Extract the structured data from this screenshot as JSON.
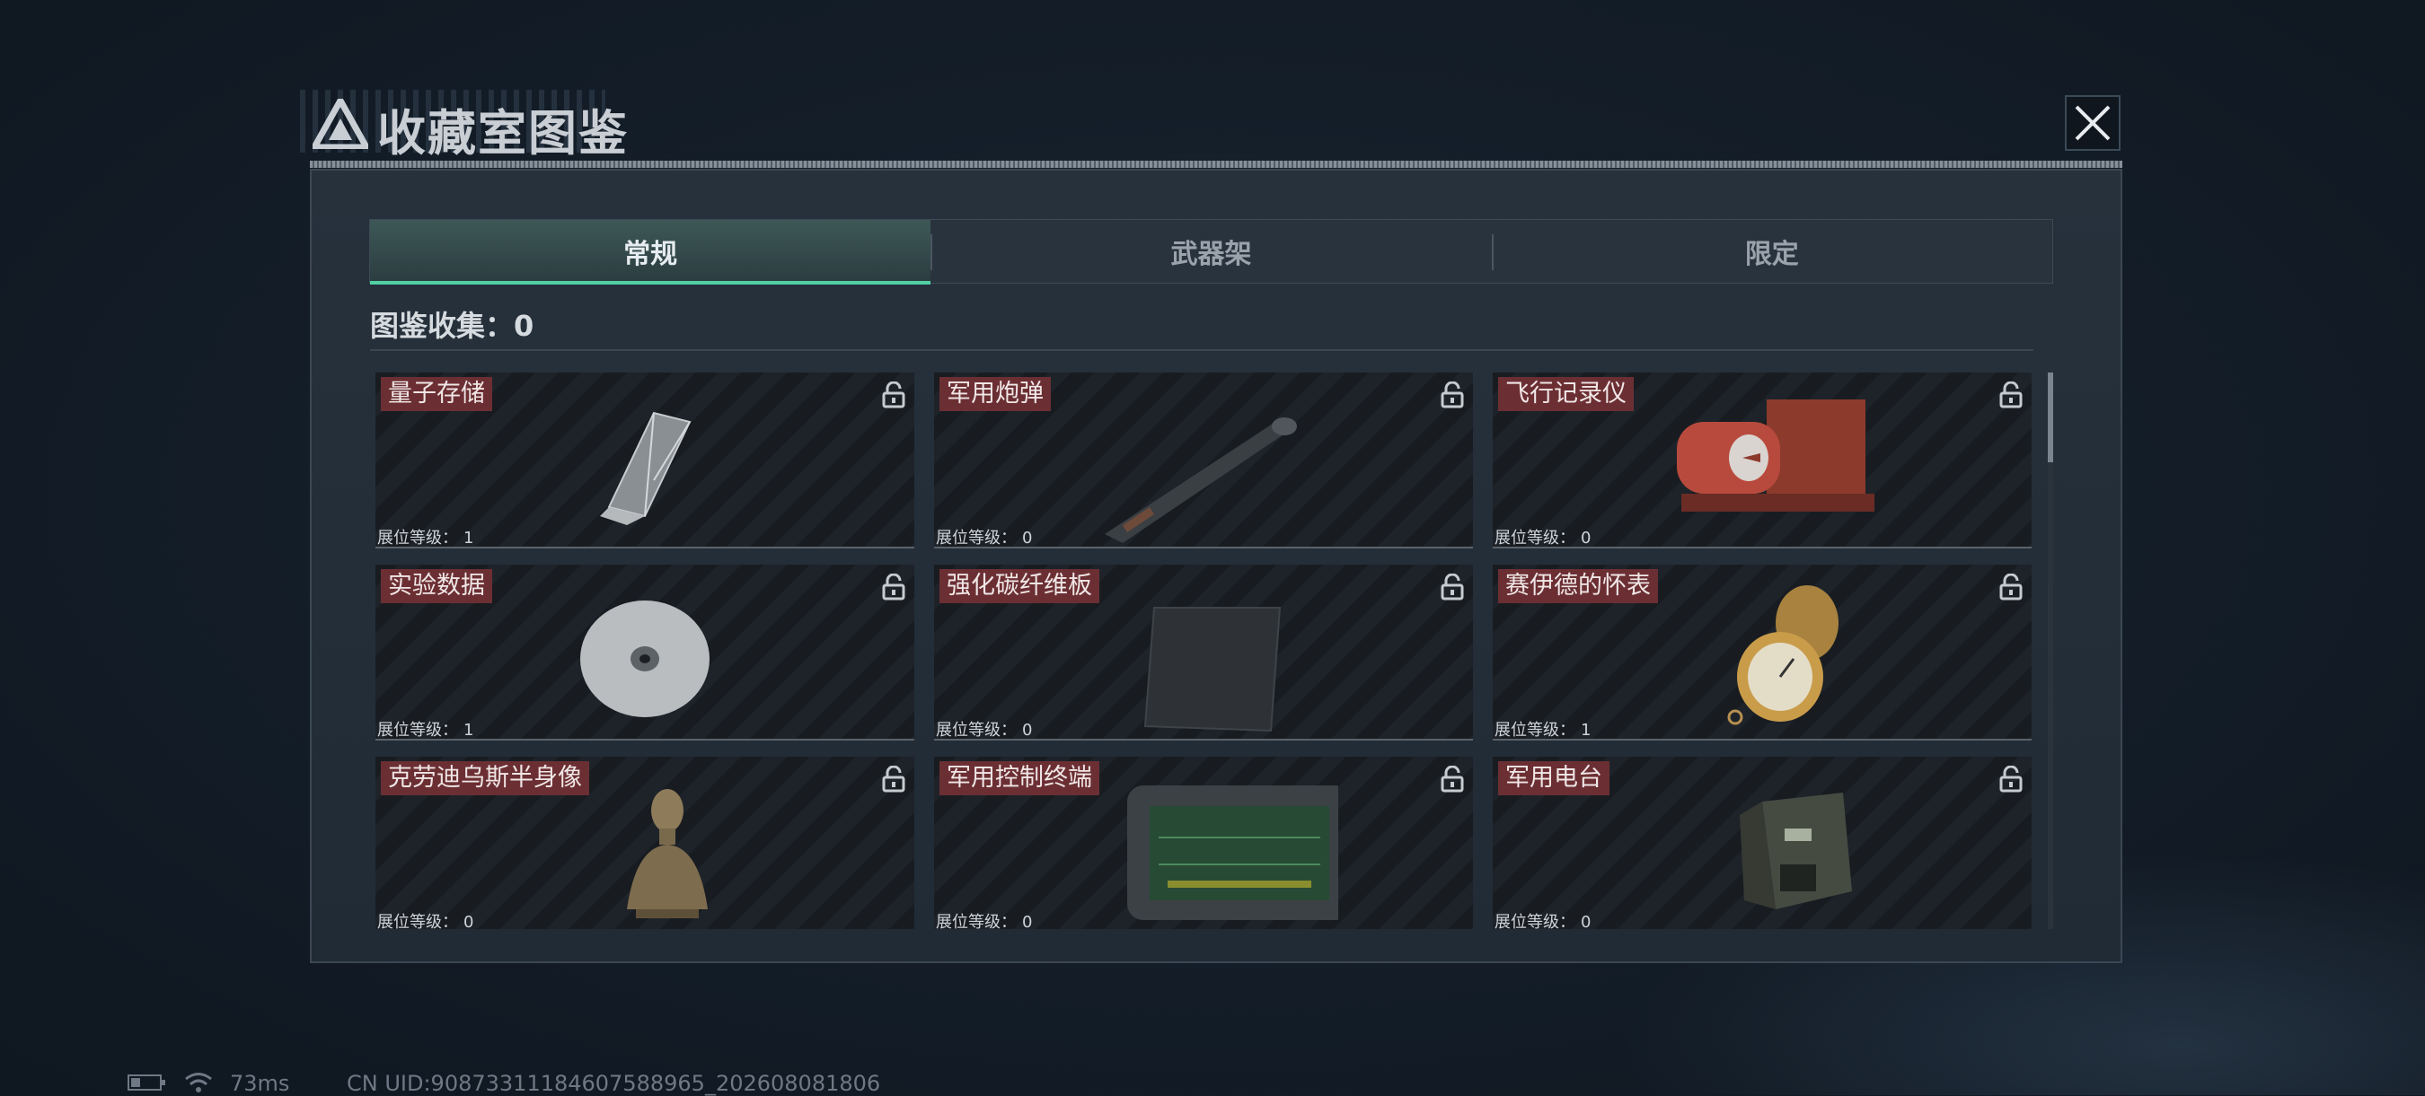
{
  "header": {
    "title": "收藏室图鉴"
  },
  "tabs": [
    {
      "label": "常规",
      "active": true
    },
    {
      "label": "武器架",
      "active": false
    },
    {
      "label": "限定",
      "active": false
    }
  ],
  "collection": {
    "label": "图鉴收集：0"
  },
  "level_label": "展位等级：",
  "items": [
    {
      "name": "量子存储",
      "level": "1",
      "icon": "usb-drive"
    },
    {
      "name": "军用炮弹",
      "level": "0",
      "icon": "artillery-shell"
    },
    {
      "name": "飞行记录仪",
      "level": "0",
      "icon": "flight-recorder"
    },
    {
      "name": "实验数据",
      "level": "1",
      "icon": "data-disc"
    },
    {
      "name": "强化碳纤维板",
      "level": "0",
      "icon": "carbon-plate"
    },
    {
      "name": "赛伊德的怀表",
      "level": "1",
      "icon": "pocket-watch"
    },
    {
      "name": "克劳迪乌斯半身像",
      "level": "0",
      "icon": "bust"
    },
    {
      "name": "军用控制终端",
      "level": "0",
      "icon": "control-terminal"
    },
    {
      "name": "军用电台",
      "level": "0",
      "icon": "military-radio"
    }
  ],
  "status": {
    "ping": "73ms",
    "uid": "CN UID:90873311184607588965_202608081806"
  },
  "colors": {
    "accent": "#4fd1a4",
    "name_tag": "#6b2f33",
    "panel": "#232d37"
  }
}
